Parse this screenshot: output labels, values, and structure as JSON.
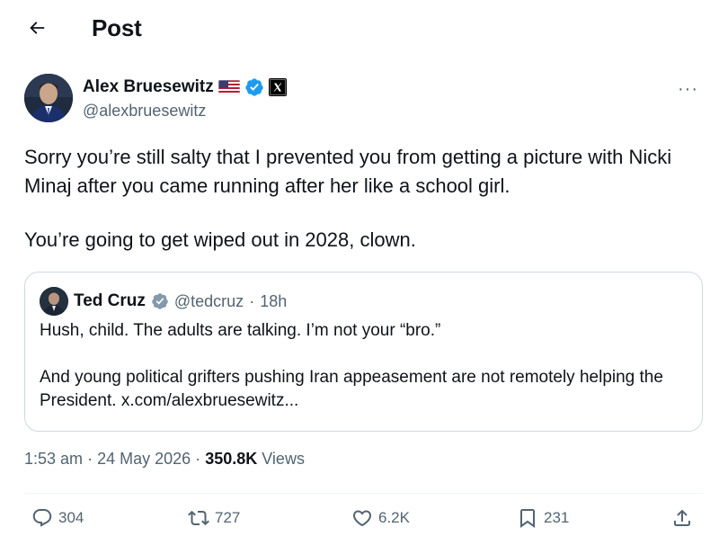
{
  "header": {
    "title": "Post",
    "back_icon": "arrow-left-icon"
  },
  "post": {
    "author_name": "Alex Bruesewitz",
    "flag_icon": "us-flag-icon",
    "verified_icon": "verified-badge-icon",
    "affiliation_icon": "x-logo-icon",
    "handle": "@alexbruesewitz",
    "more_icon": "more-dots-icon",
    "more_label": "···",
    "text_line1": "Sorry you’re still salty that I prevented you from getting a picture with Nicki Minaj after you came running after her like a school girl.",
    "text_line2": "You’re going to get wiped out in 2028, clown."
  },
  "quoted_post": {
    "author_name": "Ted Cruz",
    "verified_icon": "verified-badge-gray-icon",
    "handle": "@tedcruz",
    "separator": "·",
    "time": "18h",
    "text_line1": "Hush, child. The adults are talking. I’m not your “bro.”",
    "text_line2": "And young political grifters pushing Iran appeasement are not remotely helping the President. x.com/alexbruesewitz..."
  },
  "meta": {
    "time": "1:53 am",
    "separator": "·",
    "date": "24 May 2026",
    "views_count": "350.8K",
    "views_label": "Views"
  },
  "actions": {
    "reply_count": "304",
    "repost_count": "727",
    "like_count": "6.2K",
    "bookmark_count": "231",
    "icons": [
      "reply-icon",
      "repost-icon",
      "like-icon",
      "bookmark-icon",
      "share-icon"
    ]
  },
  "colors": {
    "text": "#0f1419",
    "secondary": "#536471",
    "verified_blue": "#1d9bf0",
    "verified_gray": "#829aab",
    "border": "#cfd9de"
  }
}
